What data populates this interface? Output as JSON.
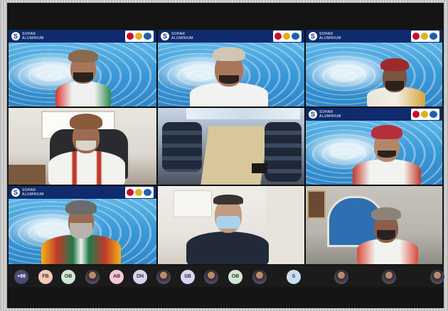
{
  "brand": {
    "logo_letter": "S",
    "name_line1": "SOHAR",
    "name_line2": "ALUMINIUM"
  },
  "participants_strip": [
    {
      "label": "+98",
      "kind": "more"
    },
    {
      "label": "FB",
      "kind": "initials"
    },
    {
      "label": "OB",
      "kind": "initials"
    },
    {
      "label": "",
      "kind": "photo"
    },
    {
      "label": "AB",
      "kind": "initials"
    },
    {
      "label": "DN",
      "kind": "initials"
    },
    {
      "label": "",
      "kind": "photo"
    },
    {
      "label": "SB",
      "kind": "initials"
    },
    {
      "label": "",
      "kind": "photo"
    },
    {
      "label": "OB",
      "kind": "initials"
    },
    {
      "label": "",
      "kind": "photo"
    },
    {
      "label": "S",
      "kind": "initials"
    },
    {
      "label": "",
      "kind": "photo"
    },
    {
      "label": "",
      "kind": "photo"
    },
    {
      "label": "",
      "kind": "photo"
    }
  ],
  "colors": {
    "brand_bar": "#0f2b6e",
    "emblem_red": "#c8102e",
    "emblem_gold": "#e0b21a",
    "emblem_blue": "#1f5fae"
  }
}
